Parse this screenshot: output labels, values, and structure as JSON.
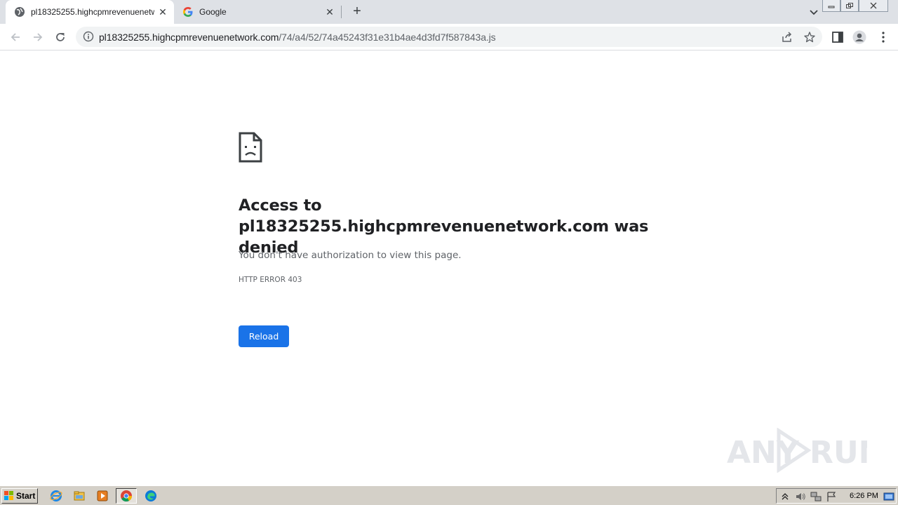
{
  "browser": {
    "tabs": [
      {
        "title": "pl18325255.highcpmrevenuenetwork.com/74/a4/52/74a45243f31e31b4ae4d3fd7f587843a.js",
        "active": true,
        "favicon": "globe-icon"
      },
      {
        "title": "Google",
        "active": false,
        "favicon": "google-g-icon"
      }
    ],
    "new_tab_label": "+",
    "address_bar": {
      "host": "pl18325255.highcpmrevenuenetwork.com",
      "path": "/74/a4/52/74a45243f31e31b4ae4d3fd7f587843a.js"
    }
  },
  "error_page": {
    "title": "Access to pl18325255.highcpmrevenuenetwork.com was denied",
    "message": "You don't have authorization to view this page.",
    "code": "HTTP ERROR 403",
    "reload_label": "Reload"
  },
  "watermark": {
    "text": "ANY RUN"
  },
  "taskbar": {
    "start_label": "Start",
    "apps": [
      "internet-explorer-icon",
      "file-explorer-icon",
      "media-player-icon",
      "chrome-icon",
      "edge-icon"
    ],
    "clock": "6:26 PM"
  },
  "colors": {
    "accent": "#1a73e8",
    "tabstrip": "#dee1e6",
    "taskbar": "#d4d0c8"
  }
}
